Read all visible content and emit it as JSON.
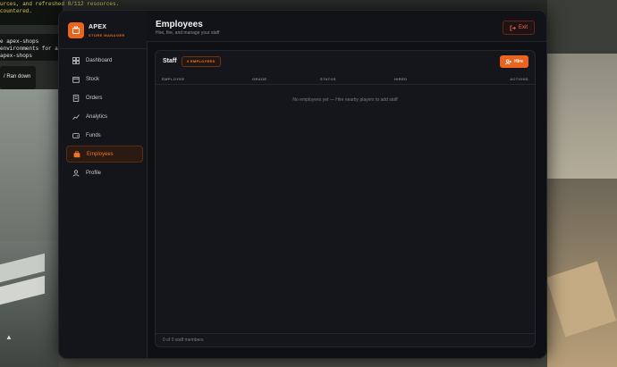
{
  "background": {
    "console_lines": [
      "urces, and refreshed 0/112 resources.",
      "countered.",
      "e apex-shops",
      "environments for ap",
      "apex-shops"
    ],
    "tooltip": "/ Ran down"
  },
  "brand": {
    "name": "APEX",
    "subtitle": "STORE MANAGER",
    "logo_icon": "store-icon",
    "accent": "#e8641f"
  },
  "nav": [
    {
      "label": "Dashboard",
      "icon": "dashboard-icon"
    },
    {
      "label": "Stock",
      "icon": "box-icon"
    },
    {
      "label": "Orders",
      "icon": "receipt-icon"
    },
    {
      "label": "Analytics",
      "icon": "chart-icon"
    },
    {
      "label": "Funds",
      "icon": "wallet-icon"
    },
    {
      "label": "Employees",
      "icon": "briefcase-icon",
      "active": true
    },
    {
      "label": "Profile",
      "icon": "user-icon"
    }
  ],
  "header": {
    "title": "Employees",
    "subtitle": "Hire, fire, and manage your staff",
    "exit_label": "Exit"
  },
  "staff": {
    "title": "Staff",
    "badge": "0 EMPLOYEES",
    "hire_label": "Hire",
    "columns": [
      "EMPLOYEE",
      "GRADE",
      "STATUS",
      "HIRED",
      "ACTIONS"
    ],
    "empty_message": "No employees yet — Hire nearby players to add staff",
    "footer": "0 of 0 staff members"
  }
}
